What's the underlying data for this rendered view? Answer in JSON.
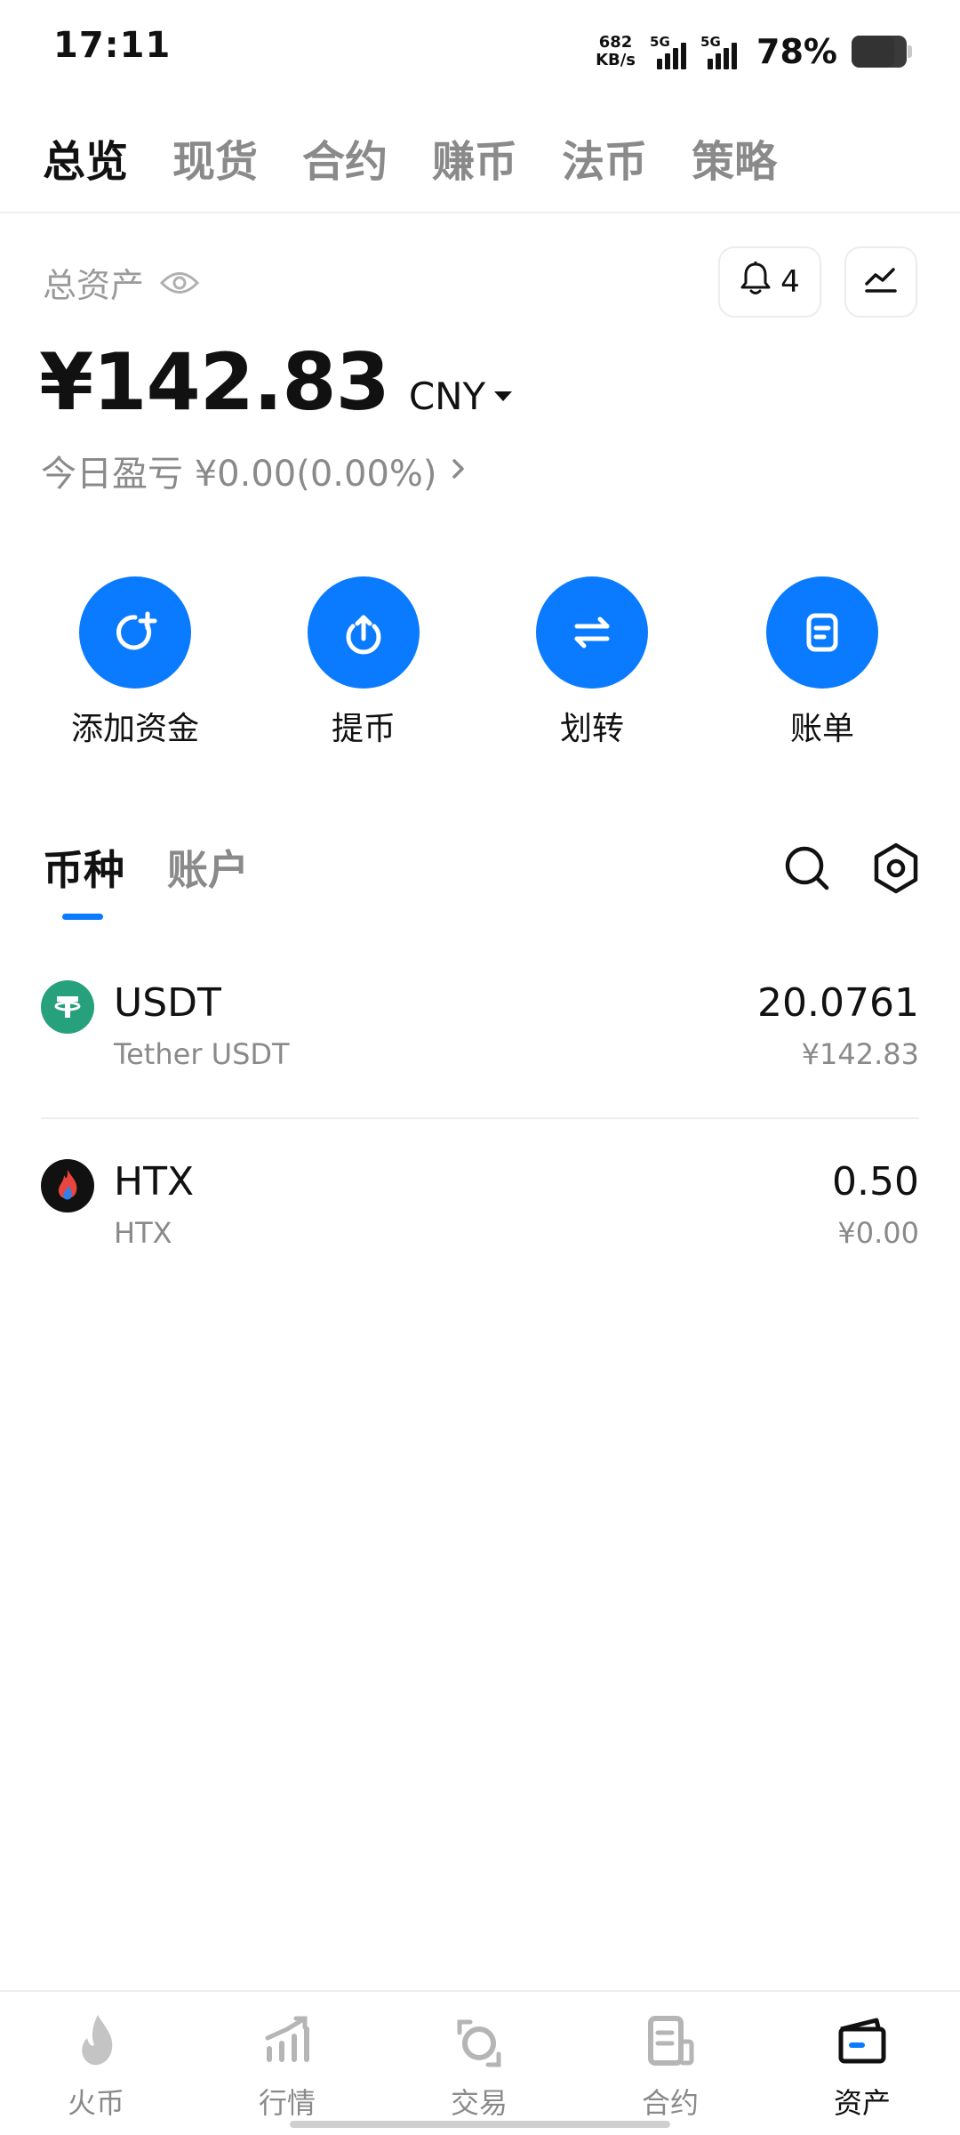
{
  "status_bar": {
    "time": "17:11",
    "net_speed_value": "682",
    "net_speed_unit": "KB/s",
    "signal1_label": "5G",
    "signal2_label": "5G",
    "battery_percent": "78%",
    "battery_level": 0.78
  },
  "top_tabs": [
    "总览",
    "现货",
    "合约",
    "赚币",
    "法币",
    "策略"
  ],
  "summary": {
    "label": "总资产",
    "notification_count": "4",
    "total_value": "¥142.83",
    "currency": "CNY",
    "today_pnl": "今日盈亏 ¥0.00(0.00%)"
  },
  "actions": [
    {
      "label": "添加资金",
      "icon": "add-funds-icon"
    },
    {
      "label": "提币",
      "icon": "withdraw-icon"
    },
    {
      "label": "划转",
      "icon": "transfer-icon"
    },
    {
      "label": "账单",
      "icon": "bill-icon"
    }
  ],
  "list_tabs": [
    "币种",
    "账户"
  ],
  "coins": [
    {
      "symbol": "USDT",
      "name": "Tether USDT",
      "amount": "20.0761",
      "value": "¥142.83",
      "logo_color": "#26a17b"
    },
    {
      "symbol": "HTX",
      "name": "HTX",
      "amount": "0.50",
      "value": "¥0.00",
      "logo_color": "#111111"
    }
  ],
  "bottom_nav": [
    {
      "label": "火币",
      "icon": "flame-icon"
    },
    {
      "label": "行情",
      "icon": "market-icon"
    },
    {
      "label": "交易",
      "icon": "trade-icon"
    },
    {
      "label": "合约",
      "icon": "contract-icon"
    },
    {
      "label": "资产",
      "icon": "wallet-icon"
    }
  ],
  "colors": {
    "accent": "#0a7aff",
    "muted_text": "#8a8a8a"
  }
}
